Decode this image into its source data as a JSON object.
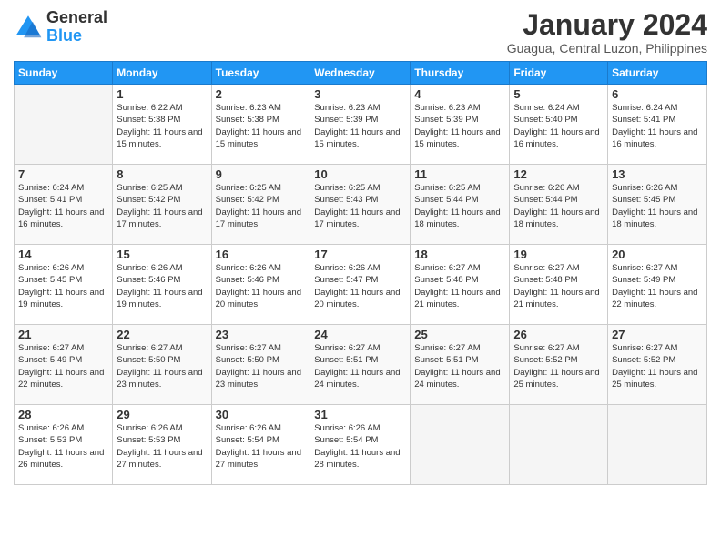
{
  "logo": {
    "general": "General",
    "blue": "Blue"
  },
  "header": {
    "title": "January 2024",
    "location": "Guagua, Central Luzon, Philippines"
  },
  "weekdays": [
    "Sunday",
    "Monday",
    "Tuesday",
    "Wednesday",
    "Thursday",
    "Friday",
    "Saturday"
  ],
  "weeks": [
    [
      {
        "day": "",
        "sunrise": "",
        "sunset": "",
        "daylight": ""
      },
      {
        "day": "1",
        "sunrise": "Sunrise: 6:22 AM",
        "sunset": "Sunset: 5:38 PM",
        "daylight": "Daylight: 11 hours and 15 minutes."
      },
      {
        "day": "2",
        "sunrise": "Sunrise: 6:23 AM",
        "sunset": "Sunset: 5:38 PM",
        "daylight": "Daylight: 11 hours and 15 minutes."
      },
      {
        "day": "3",
        "sunrise": "Sunrise: 6:23 AM",
        "sunset": "Sunset: 5:39 PM",
        "daylight": "Daylight: 11 hours and 15 minutes."
      },
      {
        "day": "4",
        "sunrise": "Sunrise: 6:23 AM",
        "sunset": "Sunset: 5:39 PM",
        "daylight": "Daylight: 11 hours and 15 minutes."
      },
      {
        "day": "5",
        "sunrise": "Sunrise: 6:24 AM",
        "sunset": "Sunset: 5:40 PM",
        "daylight": "Daylight: 11 hours and 16 minutes."
      },
      {
        "day": "6",
        "sunrise": "Sunrise: 6:24 AM",
        "sunset": "Sunset: 5:41 PM",
        "daylight": "Daylight: 11 hours and 16 minutes."
      }
    ],
    [
      {
        "day": "7",
        "sunrise": "Sunrise: 6:24 AM",
        "sunset": "Sunset: 5:41 PM",
        "daylight": "Daylight: 11 hours and 16 minutes."
      },
      {
        "day": "8",
        "sunrise": "Sunrise: 6:25 AM",
        "sunset": "Sunset: 5:42 PM",
        "daylight": "Daylight: 11 hours and 17 minutes."
      },
      {
        "day": "9",
        "sunrise": "Sunrise: 6:25 AM",
        "sunset": "Sunset: 5:42 PM",
        "daylight": "Daylight: 11 hours and 17 minutes."
      },
      {
        "day": "10",
        "sunrise": "Sunrise: 6:25 AM",
        "sunset": "Sunset: 5:43 PM",
        "daylight": "Daylight: 11 hours and 17 minutes."
      },
      {
        "day": "11",
        "sunrise": "Sunrise: 6:25 AM",
        "sunset": "Sunset: 5:44 PM",
        "daylight": "Daylight: 11 hours and 18 minutes."
      },
      {
        "day": "12",
        "sunrise": "Sunrise: 6:26 AM",
        "sunset": "Sunset: 5:44 PM",
        "daylight": "Daylight: 11 hours and 18 minutes."
      },
      {
        "day": "13",
        "sunrise": "Sunrise: 6:26 AM",
        "sunset": "Sunset: 5:45 PM",
        "daylight": "Daylight: 11 hours and 18 minutes."
      }
    ],
    [
      {
        "day": "14",
        "sunrise": "Sunrise: 6:26 AM",
        "sunset": "Sunset: 5:45 PM",
        "daylight": "Daylight: 11 hours and 19 minutes."
      },
      {
        "day": "15",
        "sunrise": "Sunrise: 6:26 AM",
        "sunset": "Sunset: 5:46 PM",
        "daylight": "Daylight: 11 hours and 19 minutes."
      },
      {
        "day": "16",
        "sunrise": "Sunrise: 6:26 AM",
        "sunset": "Sunset: 5:46 PM",
        "daylight": "Daylight: 11 hours and 20 minutes."
      },
      {
        "day": "17",
        "sunrise": "Sunrise: 6:26 AM",
        "sunset": "Sunset: 5:47 PM",
        "daylight": "Daylight: 11 hours and 20 minutes."
      },
      {
        "day": "18",
        "sunrise": "Sunrise: 6:27 AM",
        "sunset": "Sunset: 5:48 PM",
        "daylight": "Daylight: 11 hours and 21 minutes."
      },
      {
        "day": "19",
        "sunrise": "Sunrise: 6:27 AM",
        "sunset": "Sunset: 5:48 PM",
        "daylight": "Daylight: 11 hours and 21 minutes."
      },
      {
        "day": "20",
        "sunrise": "Sunrise: 6:27 AM",
        "sunset": "Sunset: 5:49 PM",
        "daylight": "Daylight: 11 hours and 22 minutes."
      }
    ],
    [
      {
        "day": "21",
        "sunrise": "Sunrise: 6:27 AM",
        "sunset": "Sunset: 5:49 PM",
        "daylight": "Daylight: 11 hours and 22 minutes."
      },
      {
        "day": "22",
        "sunrise": "Sunrise: 6:27 AM",
        "sunset": "Sunset: 5:50 PM",
        "daylight": "Daylight: 11 hours and 23 minutes."
      },
      {
        "day": "23",
        "sunrise": "Sunrise: 6:27 AM",
        "sunset": "Sunset: 5:50 PM",
        "daylight": "Daylight: 11 hours and 23 minutes."
      },
      {
        "day": "24",
        "sunrise": "Sunrise: 6:27 AM",
        "sunset": "Sunset: 5:51 PM",
        "daylight": "Daylight: 11 hours and 24 minutes."
      },
      {
        "day": "25",
        "sunrise": "Sunrise: 6:27 AM",
        "sunset": "Sunset: 5:51 PM",
        "daylight": "Daylight: 11 hours and 24 minutes."
      },
      {
        "day": "26",
        "sunrise": "Sunrise: 6:27 AM",
        "sunset": "Sunset: 5:52 PM",
        "daylight": "Daylight: 11 hours and 25 minutes."
      },
      {
        "day": "27",
        "sunrise": "Sunrise: 6:27 AM",
        "sunset": "Sunset: 5:52 PM",
        "daylight": "Daylight: 11 hours and 25 minutes."
      }
    ],
    [
      {
        "day": "28",
        "sunrise": "Sunrise: 6:26 AM",
        "sunset": "Sunset: 5:53 PM",
        "daylight": "Daylight: 11 hours and 26 minutes."
      },
      {
        "day": "29",
        "sunrise": "Sunrise: 6:26 AM",
        "sunset": "Sunset: 5:53 PM",
        "daylight": "Daylight: 11 hours and 27 minutes."
      },
      {
        "day": "30",
        "sunrise": "Sunrise: 6:26 AM",
        "sunset": "Sunset: 5:54 PM",
        "daylight": "Daylight: 11 hours and 27 minutes."
      },
      {
        "day": "31",
        "sunrise": "Sunrise: 6:26 AM",
        "sunset": "Sunset: 5:54 PM",
        "daylight": "Daylight: 11 hours and 28 minutes."
      },
      {
        "day": "",
        "sunrise": "",
        "sunset": "",
        "daylight": ""
      },
      {
        "day": "",
        "sunrise": "",
        "sunset": "",
        "daylight": ""
      },
      {
        "day": "",
        "sunrise": "",
        "sunset": "",
        "daylight": ""
      }
    ]
  ]
}
